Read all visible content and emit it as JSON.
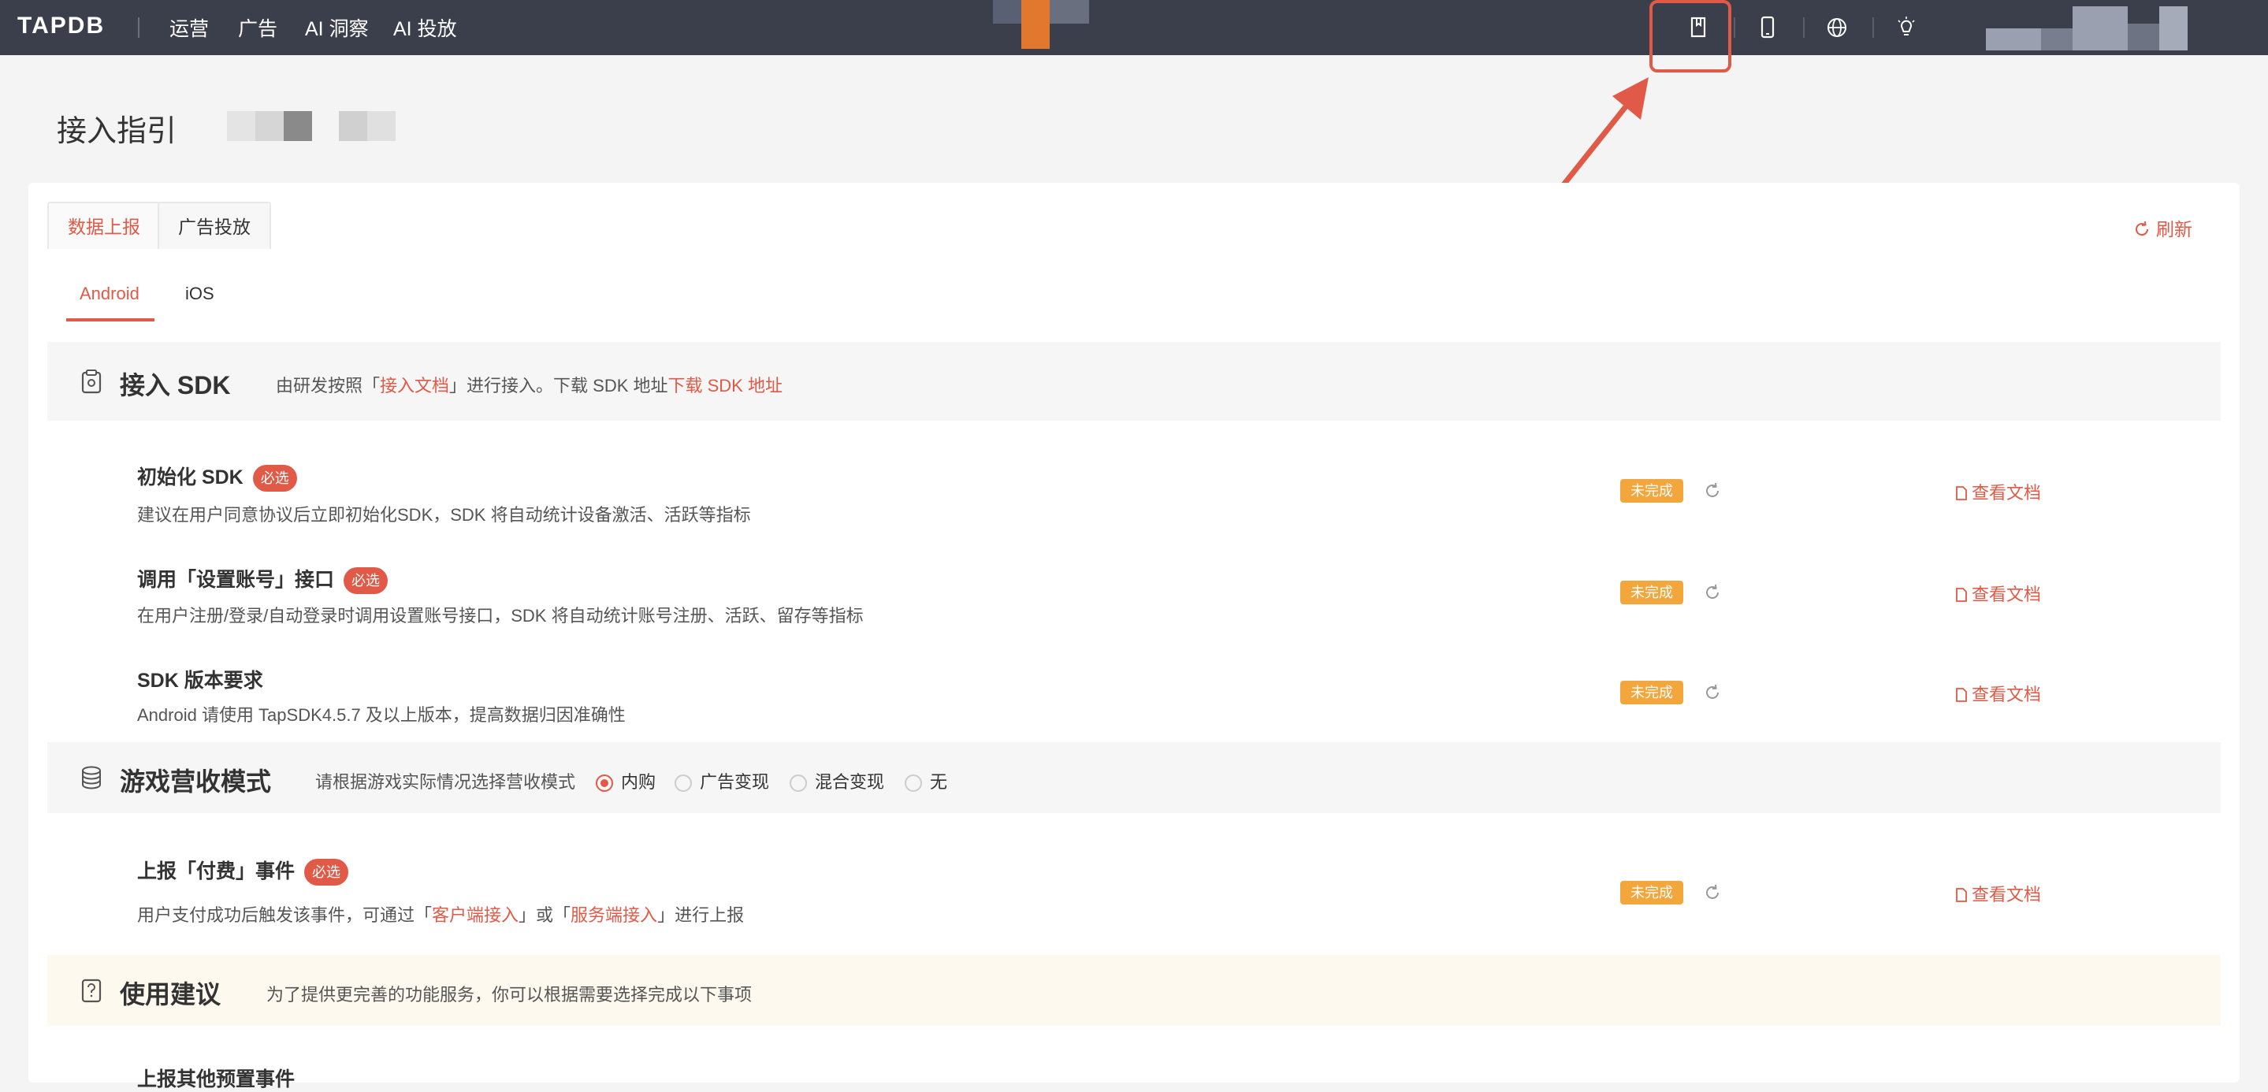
{
  "topbar": {
    "logo": "TAPDB",
    "nav": [
      "运营",
      "广告",
      "AI 洞察",
      "AI 投放"
    ],
    "icons": [
      "doc-guide-icon",
      "mobile-icon",
      "globe-icon",
      "bulb-icon"
    ]
  },
  "page": {
    "title": "接入指引"
  },
  "tabs": {
    "data_report": "数据上报",
    "ad_delivery": "广告投放"
  },
  "refresh_label": "刷新",
  "platform_tabs": {
    "android": "Android",
    "ios": "iOS"
  },
  "sdk_section": {
    "title": "接入 SDK",
    "desc_before": "由研发按照「",
    "desc_link": "接入文档",
    "desc_mid": "」进行接入。下载 SDK 地址",
    "download_link": "下载 SDK 地址"
  },
  "tasks": [
    {
      "title": "初始化 SDK",
      "badge": "必选",
      "desc": "建议在用户同意协议后立即初始化SDK，SDK 将自动统计设备激活、活跃等指标",
      "status": "未完成",
      "doc": "查看文档"
    },
    {
      "title": "调用「设置账号」接口",
      "badge": "必选",
      "desc": "在用户注册/登录/自动登录时调用设置账号接口，SDK 将自动统计账号注册、活跃、留存等指标",
      "status": "未完成",
      "doc": "查看文档"
    },
    {
      "title": "SDK 版本要求",
      "desc": "Android 请使用 TapSDK4.5.7 及以上版本，提高数据归因准确性",
      "status": "未完成",
      "doc": "查看文档"
    }
  ],
  "revenue_section": {
    "title": "游戏营收模式",
    "desc": "请根据游戏实际情况选择营收模式",
    "options": [
      "内购",
      "广告变现",
      "混合变现",
      "无"
    ],
    "selected": "内购"
  },
  "payment_task": {
    "title": "上报「付费」事件",
    "badge": "必选",
    "desc_before": "用户支付成功后触发该事件，可通过「",
    "link1": "客户端接入",
    "desc_mid": "」或「",
    "link2": "服务端接入",
    "desc_after": "」进行上报",
    "status": "未完成",
    "doc": "查看文档"
  },
  "advice_section": {
    "title": "使用建议",
    "desc": "为了提供更完善的功能服务，你可以根据需要选择完成以下事项"
  },
  "partial_task_title": "上报其他预置事件",
  "colors": {
    "accent": "#e05a47",
    "topbar": "#3b3f4c",
    "warning": "#f2a63b"
  }
}
